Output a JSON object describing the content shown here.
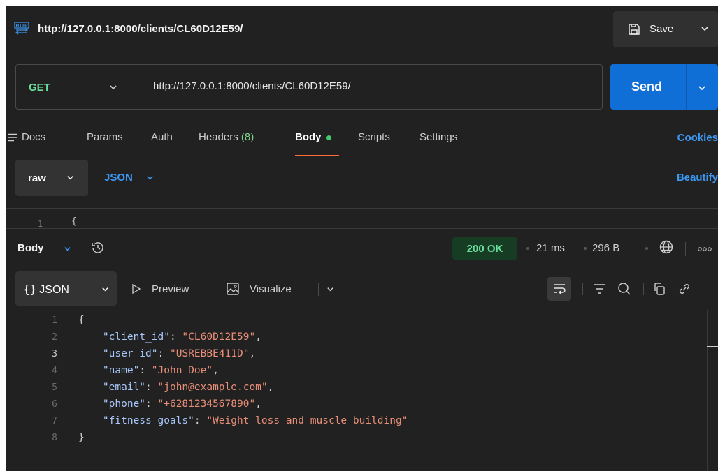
{
  "header": {
    "url": "http://127.0.0.1:8000/clients/CL60D12E59/",
    "save_label": "Save"
  },
  "request": {
    "method": "GET",
    "url": "http://127.0.0.1:8000/clients/CL60D12E59/",
    "send_label": "Send"
  },
  "tabs": {
    "docs": "Docs",
    "params": "Params",
    "auth": "Auth",
    "headers": "Headers",
    "headers_count": "(8)",
    "body": "Body",
    "scripts": "Scripts",
    "settings": "Settings",
    "cookies": "Cookies",
    "active": "Body"
  },
  "body_type": {
    "mode": "raw",
    "format": "JSON",
    "beautify": "Beautify",
    "editor_line": "1",
    "editor_text": "{"
  },
  "response": {
    "title": "Body",
    "status": "200 OK",
    "time": "21 ms",
    "size": "296 B",
    "format": "JSON",
    "format_braces": "{}",
    "preview": "Preview",
    "visualize": "Visualize",
    "lines": [
      {
        "n": "1",
        "open": "{"
      },
      {
        "n": "2",
        "key": "\"client_id\"",
        "value": "\"CL60D12E59\"",
        "end": ","
      },
      {
        "n": "3",
        "key": "\"user_id\"",
        "value": "\"USREBBE411D\"",
        "end": ","
      },
      {
        "n": "4",
        "key": "\"name\"",
        "value": "\"John Doe\"",
        "end": ","
      },
      {
        "n": "5",
        "key": "\"email\"",
        "value": "\"john@example.com\"",
        "end": ","
      },
      {
        "n": "6",
        "key": "\"phone\"",
        "value": "\"+6281234567890\"",
        "end": ","
      },
      {
        "n": "7",
        "key": "\"fitness_goals\"",
        "value": "\"Weight loss and muscle building\"",
        "end": ""
      },
      {
        "n": "8",
        "open": "}"
      }
    ]
  },
  "colors": {
    "background": "#212121",
    "method_green": "#6bdd9a",
    "send_blue": "#0f6fd6",
    "link_blue": "#3d98f2",
    "active_tab_underline": "#ff6c37",
    "json_key": "#a8c7fa",
    "json_string": "#e88e78",
    "status_bg": "#163d24"
  }
}
